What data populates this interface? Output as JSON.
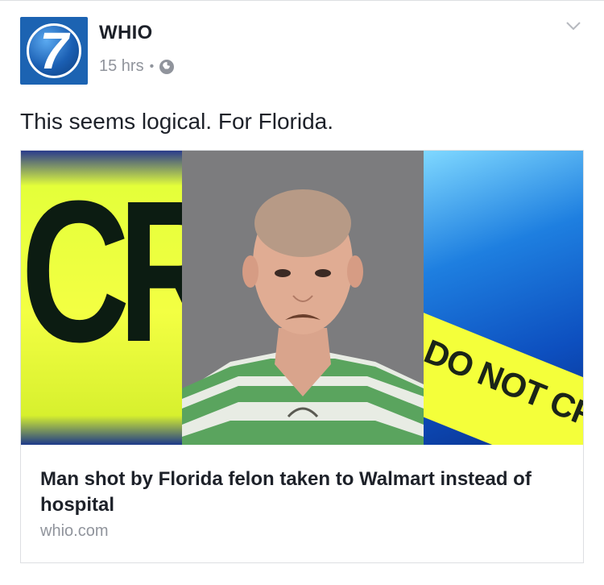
{
  "post": {
    "page_name": "WHIO",
    "timestamp": "15 hrs",
    "separator": "•",
    "privacy_icon": "globe-icon",
    "menu_icon": "chevron-down-icon",
    "message": "This seems logical. For Florida."
  },
  "avatar": {
    "glyph": "7",
    "colors": {
      "background": "#1c63b2",
      "ring": "#ffffff"
    }
  },
  "link_card": {
    "image": {
      "left_panel_text": "CR",
      "right_panel_text": "DO NOT CROSS"
    },
    "title": "Man shot by Florida felon taken to Walmart instead of hospital",
    "domain": "whio.com"
  },
  "colors": {
    "text_primary": "#1d2129",
    "text_secondary": "#90949c",
    "border": "#dddfe2",
    "tape_yellow": "#f3ff43"
  }
}
